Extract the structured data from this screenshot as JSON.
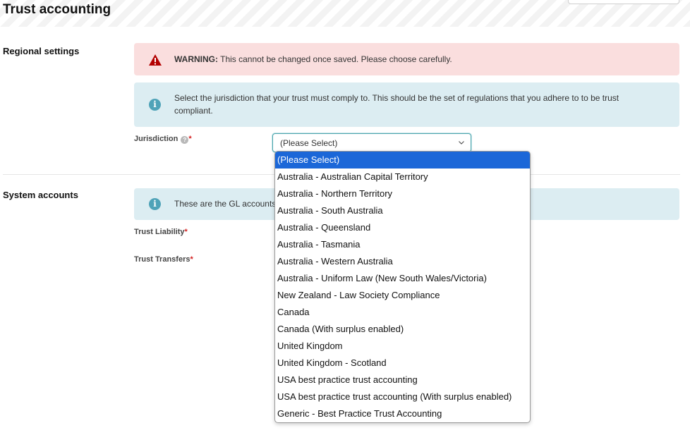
{
  "page": {
    "title": "Trust accounting"
  },
  "regional": {
    "label": "Regional settings",
    "warning_prefix": "WARNING:",
    "warning_text": " This cannot be changed once saved. Please choose carefully.",
    "info_text": "Select the jurisdiction that your trust must comply to. This should be the set of regulations that you adhere to to be trust compliant.",
    "jurisdiction_label": "Jurisdiction",
    "required_mark": "*",
    "selected_value": "(Please Select)"
  },
  "system": {
    "label": "System accounts",
    "info_text": "These are the GL accounts",
    "trust_liability_label": "Trust Liability",
    "trust_transfers_label": "Trust Transfers",
    "required_mark": "*"
  },
  "dropdown": {
    "options": [
      "(Please Select)",
      "Australia - Australian Capital Territory",
      "Australia - Northern Territory",
      "Australia - South Australia",
      "Australia - Queensland",
      "Australia - Tasmania",
      "Australia - Western Australia",
      "Australia - Uniform Law (New South Wales/Victoria)",
      "New Zealand - Law Society Compliance",
      "Canada",
      "Canada (With surplus enabled)",
      "United Kingdom",
      "United Kingdom - Scotland",
      "USA best practice trust accounting",
      "USA best practice trust accounting (With surplus enabled)",
      "Generic - Best Practice Trust Accounting"
    ],
    "selected_index": 0
  },
  "colors": {
    "warning_bg": "#fadede",
    "warning_icon": "#b30000",
    "info_bg": "#dcedf2",
    "info_icon": "#4fa3b8",
    "selected_option_bg": "#1b67d8",
    "select_border": "#4ba5ad"
  }
}
